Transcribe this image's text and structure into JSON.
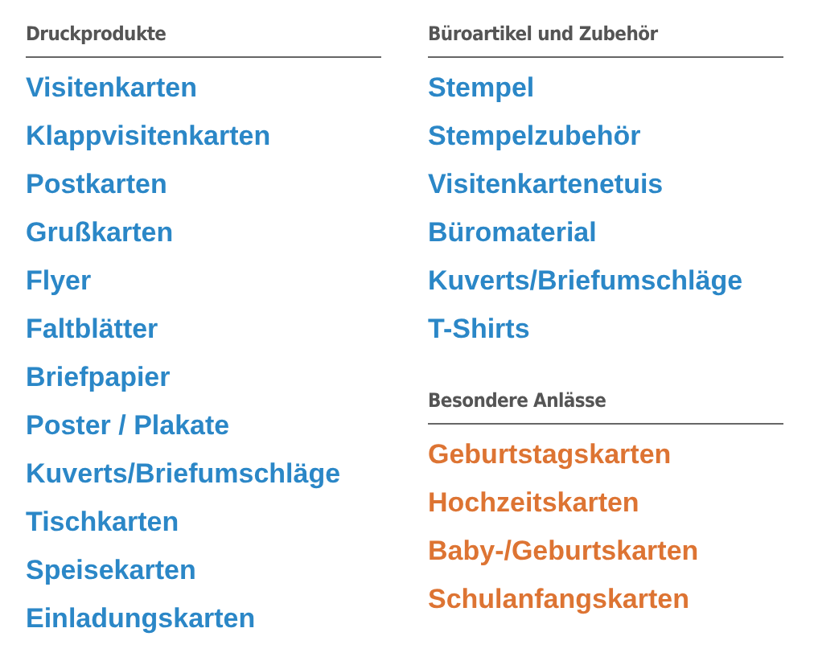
{
  "columns": [
    {
      "sections": [
        {
          "heading": "Druckprodukte",
          "kind": "regular",
          "links": [
            "Visitenkarten",
            "Klappvisitenkarten",
            "Postkarten",
            "Grußkarten",
            "Flyer",
            "Faltblätter",
            "Briefpapier",
            "Poster / Plakate",
            "Kuverts/Briefumschläge",
            "Tischkarten",
            "Speisekarten",
            "Einladungskarten"
          ]
        }
      ]
    },
    {
      "sections": [
        {
          "heading": "Büroartikel und Zubehör",
          "kind": "regular",
          "links": [
            "Stempel",
            "Stempelzubehör",
            "Visitenkartenetuis",
            "Büromaterial",
            "Kuverts/Briefumschläge",
            "T-Shirts"
          ]
        },
        {
          "heading": "Besondere Anlässe",
          "kind": "occasion",
          "links": [
            "Geburtstagskarten",
            "Hochzeitskarten",
            "Baby-/Geburtskarten",
            "Schulanfangskarten"
          ]
        }
      ]
    }
  ]
}
